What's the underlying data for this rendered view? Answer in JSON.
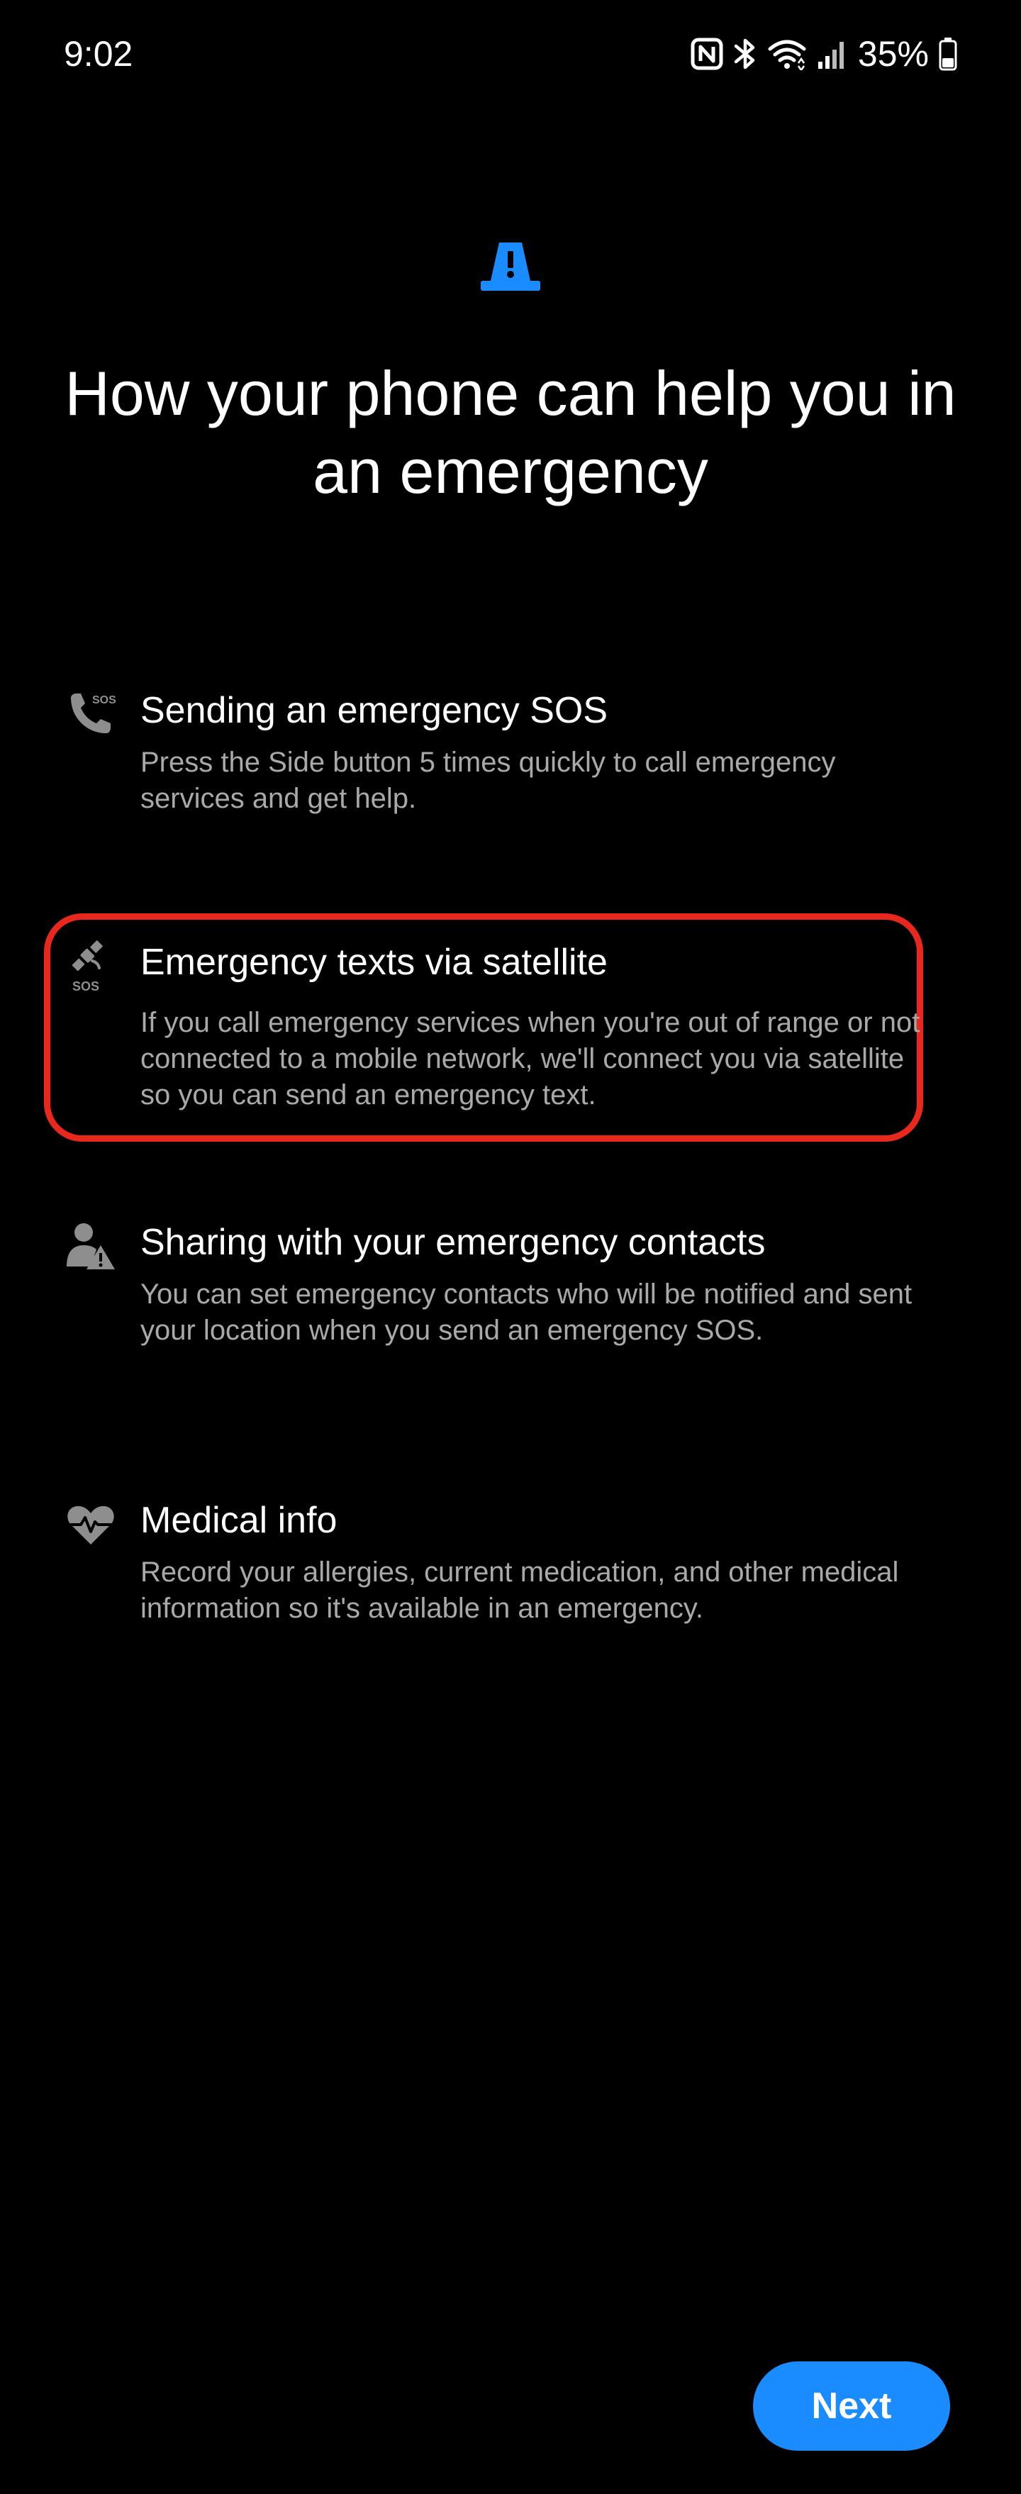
{
  "status_bar": {
    "time": "9:02",
    "battery_percent": "35%",
    "icons": [
      "nfc-icon",
      "bluetooth-icon",
      "wifi-icon",
      "signal-icon",
      "battery-icon"
    ]
  },
  "header": {
    "icon": "alert-triangle-icon",
    "title": "How your phone can help you in an emergency"
  },
  "features": [
    {
      "icon": "sos-phone-icon",
      "title": "Sending an emergency SOS",
      "description": "Press the Side button 5 times quickly to call emergency services and get help."
    },
    {
      "icon": "satellite-sos-icon",
      "title": "Emergency texts via satellite",
      "description": "If you call emergency services when you're out of range or not connected to a mobile network, we'll connect you via satellite so you can send an emergency text.",
      "highlighted": true
    },
    {
      "icon": "emergency-contact-icon",
      "title": "Sharing with your emergency contacts",
      "description": "You can set emergency contacts who will be notified and sent your location when you send an emergency SOS."
    },
    {
      "icon": "heart-pulse-icon",
      "title": "Medical info",
      "description": "Record your allergies, current medication, and other medical information so it's available in an emergency."
    }
  ],
  "actions": {
    "next_label": "Next"
  },
  "colors": {
    "background": "#000000",
    "accent": "#1a8cff",
    "highlight": "#e8281c",
    "secondary_text": "#a9a9a9",
    "icon_gray": "#8e8e8e"
  }
}
